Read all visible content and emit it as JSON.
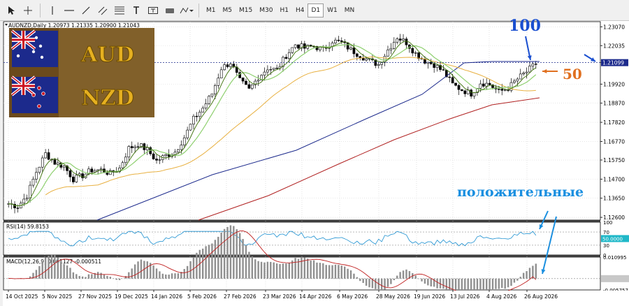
{
  "toolbar": {
    "timeframes": [
      "M1",
      "M5",
      "M15",
      "M30",
      "H1",
      "H4",
      "D1",
      "W1",
      "MN"
    ],
    "active": "D1"
  },
  "chart": {
    "title": "AUDNZD,Daily  1.20973 1.21335 1.20900 1.21043",
    "price_label": "1.21099",
    "flag_text_1": "AUD",
    "flag_text_2": "NZD",
    "colors": {
      "bull": "#000000",
      "ma_fast": "#4a7a1a",
      "ma_mid": "#8fd070",
      "ma_50": "#e8b040",
      "ma_100": "#1c2a8c",
      "ma_200": "#b02020",
      "price_line": "#1c2a8c",
      "annotation_blue": "#1a4fd0",
      "annotation_orange": "#e07020",
      "annotation_cyan": "#1a8fe0"
    }
  },
  "annotations": {
    "ma100_label": "100",
    "ma50_label": "50",
    "positive_label": "положительные"
  },
  "rsi": {
    "label": "RSI(14) 59.8153",
    "levels": [
      "100",
      "70",
      "30",
      "0"
    ],
    "current_label": "50.0000"
  },
  "macd": {
    "label": "MACD(12,26,9) 0.001127 -0.000511",
    "levels": [
      "0.010995",
      "0.000000",
      "-0.005757"
    ]
  },
  "chart_data": {
    "type": "candlestick",
    "symbol": "AUDNZD",
    "timeframe": "Daily",
    "x_ticks": [
      "14 Oct 2025",
      "5 Nov 2025",
      "27 Nov 2025",
      "19 Dec 2025",
      "14 Jan 2026",
      "5 Feb 2026",
      "27 Feb 2026",
      "23 Mar 2026",
      "14 Apr 2026",
      "6 May 2026",
      "28 May 2026",
      "19 Jun 2026",
      "13 Jul 2026",
      "4 Aug 2026",
      "26 Aug 2026"
    ],
    "y_ticks": [
      "1.23070",
      "1.22035",
      "1.21099",
      "1.19920",
      "1.18870",
      "1.17820",
      "1.16770",
      "1.15750",
      "1.14700",
      "1.13650",
      "1.12600"
    ],
    "ylim": [
      1.1245,
      1.2335
    ],
    "close_path": [
      [
        0,
        1.1335
      ],
      [
        3,
        1.132
      ],
      [
        6,
        1.138
      ],
      [
        9,
        1.151
      ],
      [
        12,
        1.161
      ],
      [
        15,
        1.156
      ],
      [
        18,
        1.154
      ],
      [
        21,
        1.147
      ],
      [
        24,
        1.149
      ],
      [
        27,
        1.152
      ],
      [
        30,
        1.152
      ],
      [
        33,
        1.15
      ],
      [
        36,
        1.153
      ],
      [
        39,
        1.164
      ],
      [
        42,
        1.166
      ],
      [
        45,
        1.163
      ],
      [
        48,
        1.157
      ],
      [
        51,
        1.16
      ],
      [
        54,
        1.162
      ],
      [
        57,
        1.17
      ],
      [
        60,
        1.18
      ],
      [
        63,
        1.186
      ],
      [
        66,
        1.194
      ],
      [
        69,
        1.208
      ],
      [
        72,
        1.211
      ],
      [
        75,
        1.201
      ],
      [
        78,
        1.196
      ],
      [
        81,
        1.203
      ],
      [
        84,
        1.208
      ],
      [
        87,
        1.207
      ],
      [
        90,
        1.215
      ],
      [
        93,
        1.221
      ],
      [
        96,
        1.219
      ],
      [
        99,
        1.22
      ],
      [
        102,
        1.218
      ],
      [
        105,
        1.223
      ],
      [
        108,
        1.222
      ],
      [
        111,
        1.218
      ],
      [
        114,
        1.215
      ],
      [
        117,
        1.212
      ],
      [
        120,
        1.21
      ],
      [
        123,
        1.218
      ],
      [
        126,
        1.225
      ],
      [
        129,
        1.222
      ],
      [
        132,
        1.216
      ],
      [
        135,
        1.212
      ],
      [
        138,
        1.21
      ],
      [
        141,
        1.206
      ],
      [
        144,
        1.199
      ],
      [
        147,
        1.196
      ],
      [
        150,
        1.194
      ],
      [
        153,
        1.2
      ],
      [
        156,
        1.199
      ],
      [
        159,
        1.195
      ],
      [
        162,
        1.197
      ],
      [
        165,
        1.202
      ],
      [
        168,
        1.206
      ],
      [
        171,
        1.2104
      ]
    ],
    "rsi_current": 59.8153,
    "macd_main": 0.001127,
    "macd_signal": -0.000511
  }
}
